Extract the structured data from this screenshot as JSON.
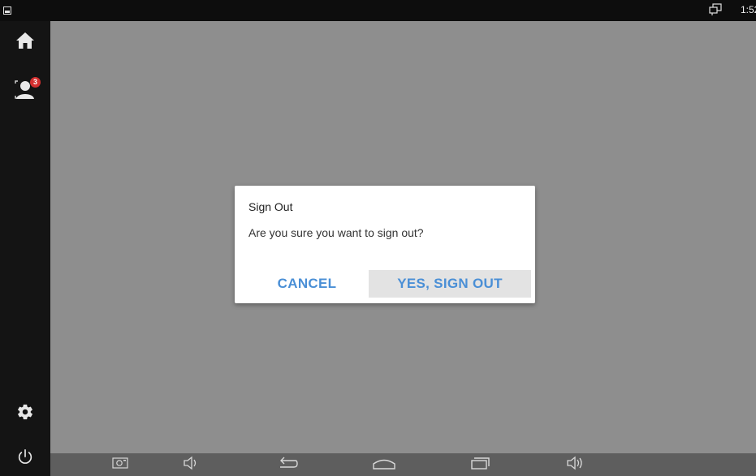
{
  "status_bar": {
    "time": "1:52",
    "icons": [
      "notification-image-icon",
      "cast-screen-icon"
    ]
  },
  "side_rail": {
    "items": [
      {
        "name": "home",
        "icon": "home-icon"
      },
      {
        "name": "contacts",
        "icon": "contact-person-icon",
        "badge": "3"
      },
      {
        "name": "settings",
        "icon": "gear-icon"
      },
      {
        "name": "power",
        "icon": "power-icon"
      }
    ]
  },
  "dialog": {
    "title": "Sign Out",
    "message": "Are you sure you want to sign out?",
    "cancel_label": "CANCEL",
    "confirm_label": "YES, SIGN OUT"
  },
  "nav_bar": {
    "buttons": [
      "screenshot-icon",
      "volume-down-icon",
      "back-icon",
      "home-outline-icon",
      "recents-icon",
      "volume-up-icon"
    ]
  },
  "colors": {
    "scrim": "#8e8e8e",
    "rail": "#141414",
    "accent": "#4a8fd6",
    "badge": "#d32f2f",
    "nav_bar": "#5e5e5e"
  }
}
